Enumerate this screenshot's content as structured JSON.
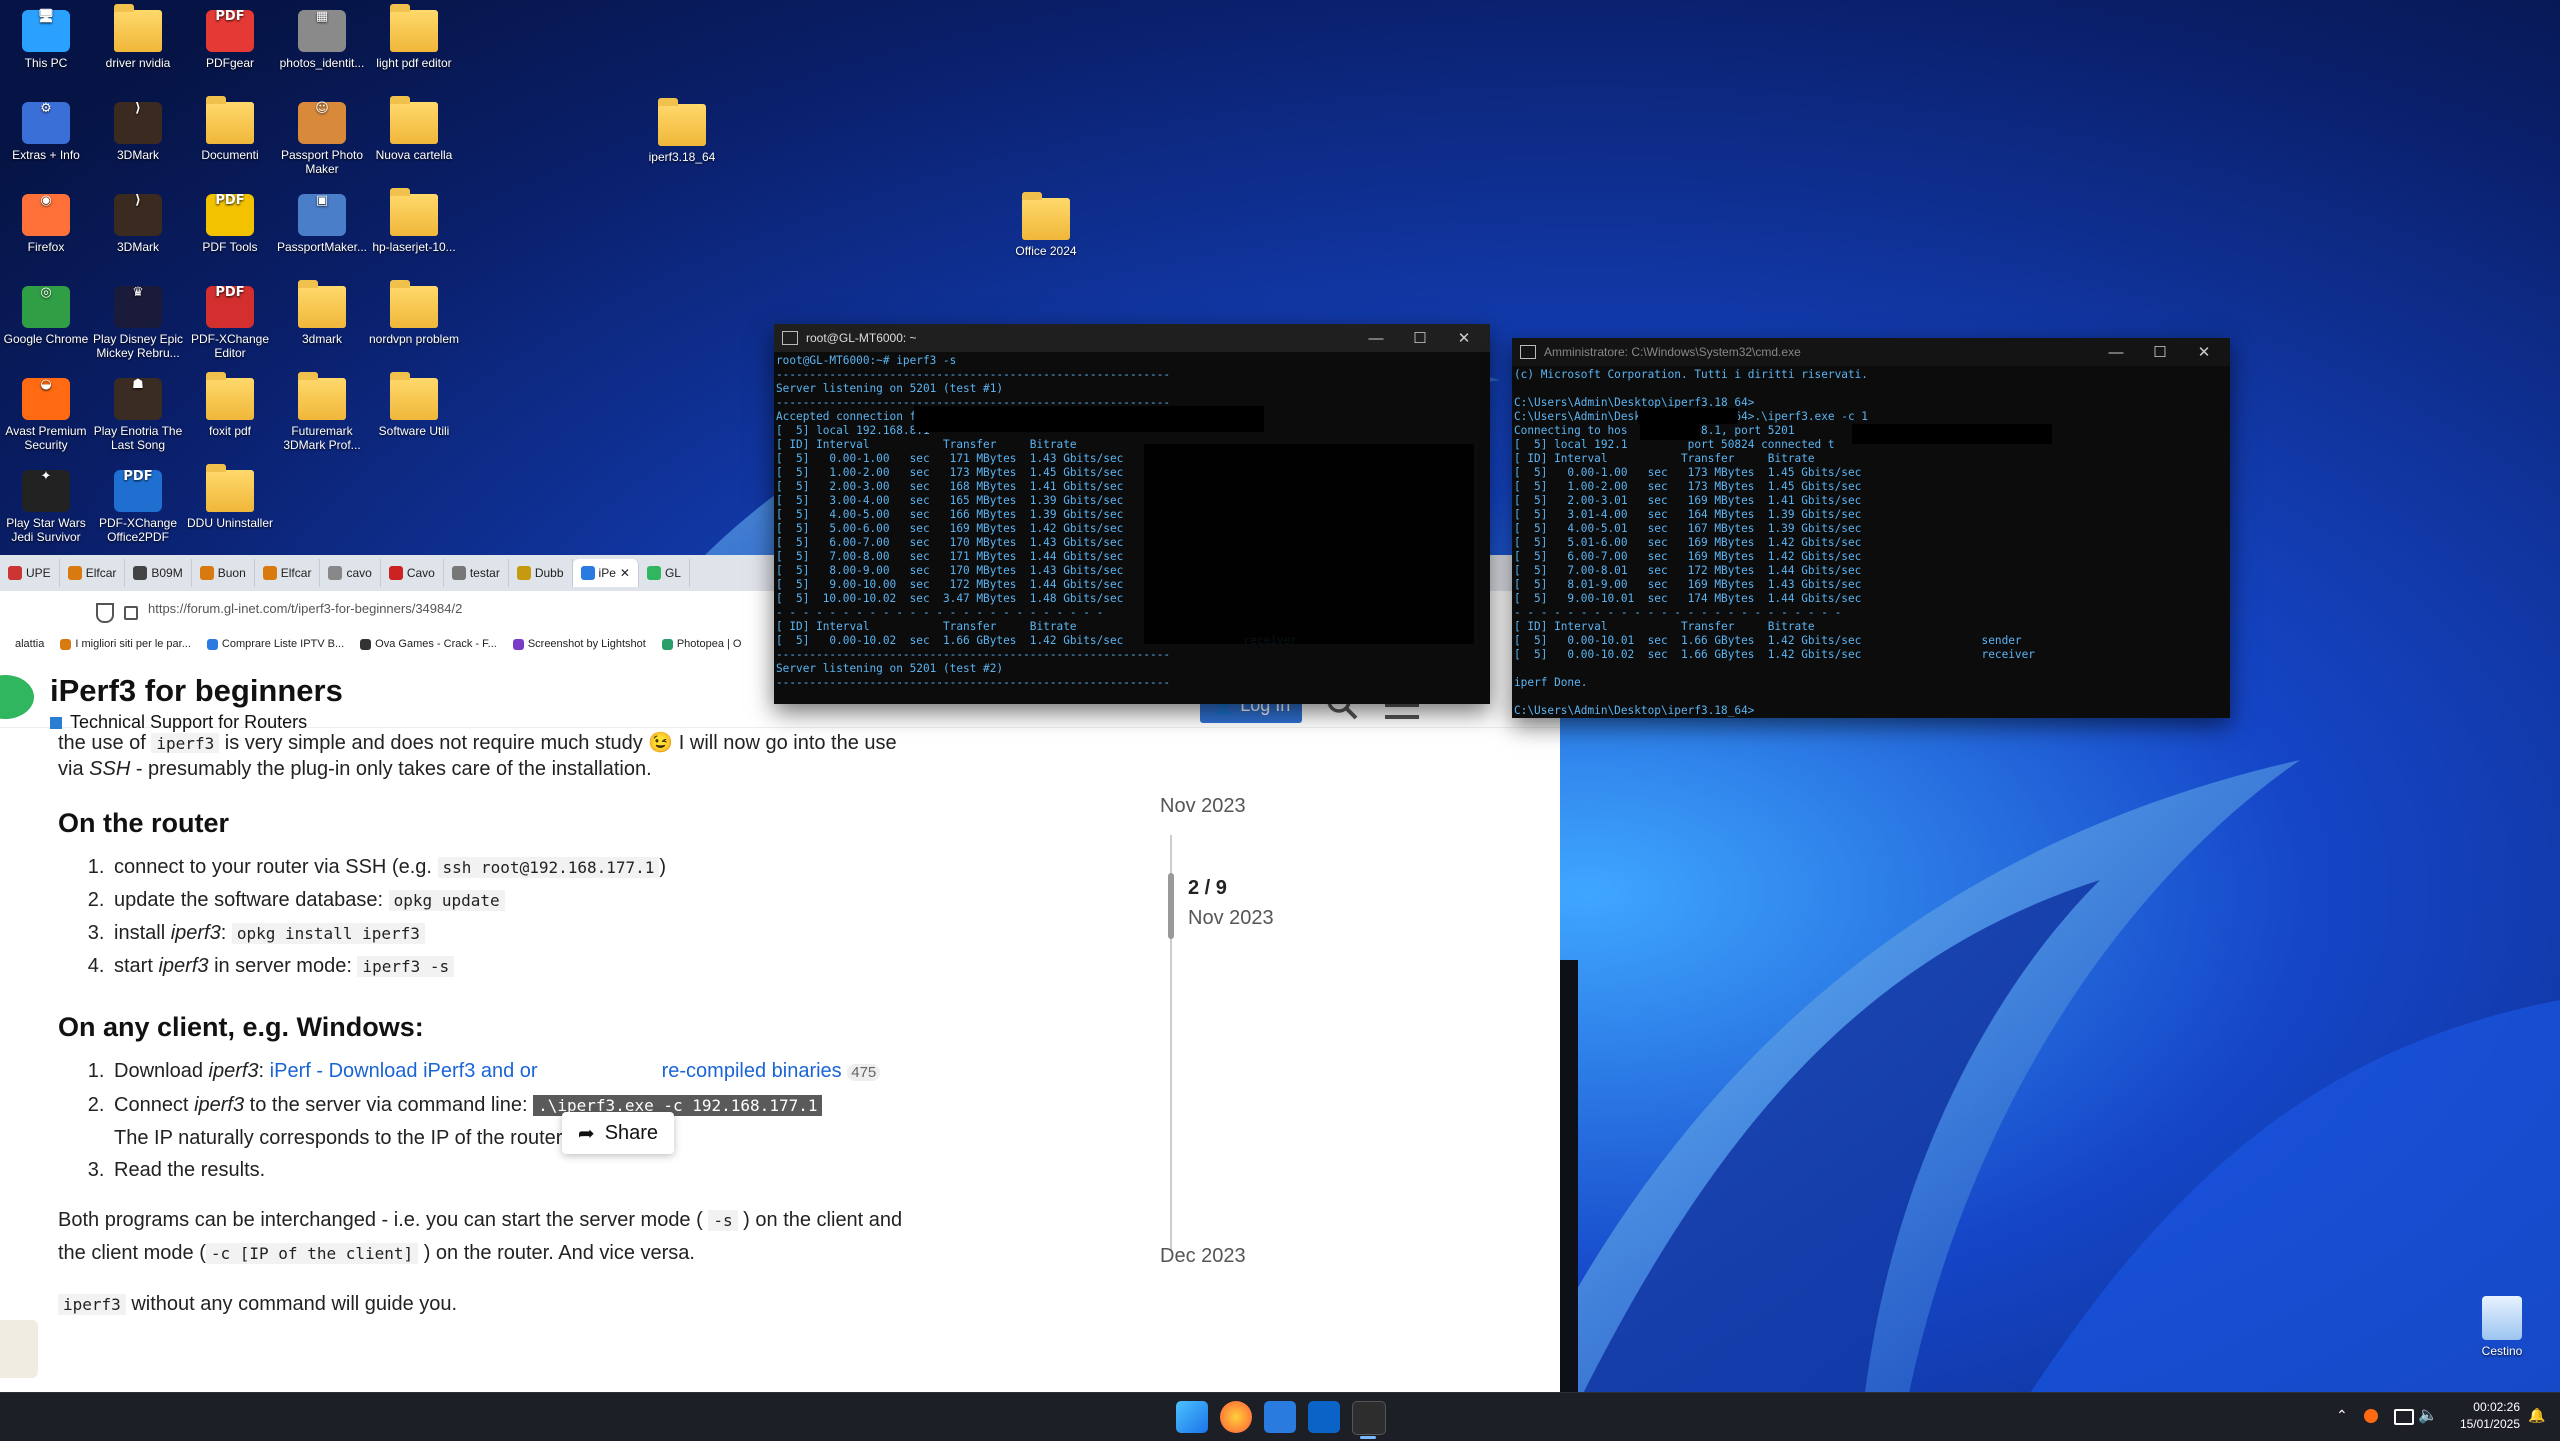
{
  "desktop": {
    "icons": [
      {
        "label": "This PC",
        "color": "#2aa0ff",
        "kind": "tile",
        "glyph": "🖥"
      },
      {
        "label": "driver nvidia",
        "color": "#f0b73a",
        "kind": "folder"
      },
      {
        "label": "PDFgear",
        "color": "#e53935",
        "kind": "tile",
        "glyph": "PDF"
      },
      {
        "label": "photos_identit...",
        "color": "#8a8a8a",
        "kind": "tile",
        "glyph": "▦"
      },
      {
        "label": "light pdf editor",
        "color": "#f0b73a",
        "kind": "folder"
      },
      {
        "label": "Extras + Info",
        "color": "#3b6fd8",
        "kind": "tile",
        "glyph": "⚙"
      },
      {
        "label": "3DMark",
        "color": "#3a2a20",
        "kind": "tile",
        "glyph": "⟩"
      },
      {
        "label": "Documenti",
        "color": "#f0b73a",
        "kind": "folder"
      },
      {
        "label": "Passport Photo Maker",
        "color": "#d88a3a",
        "kind": "tile",
        "glyph": "☺"
      },
      {
        "label": "Nuova cartella",
        "color": "#f0b73a",
        "kind": "folder"
      },
      {
        "label": "Firefox",
        "color": "#ff7139",
        "kind": "tile",
        "glyph": "◉"
      },
      {
        "label": "3DMark",
        "color": "#3a2a20",
        "kind": "tile",
        "glyph": "⟩"
      },
      {
        "label": "PDF Tools",
        "color": "#f2c200",
        "kind": "tile",
        "glyph": "PDF"
      },
      {
        "label": "PassportMaker...",
        "color": "#4a7ec9",
        "kind": "tile",
        "glyph": "▣"
      },
      {
        "label": "hp-laserjet-10...",
        "color": "#f0b73a",
        "kind": "folder"
      },
      {
        "label": "Google Chrome",
        "color": "#2f9e44",
        "kind": "tile",
        "glyph": "◎"
      },
      {
        "label": "Play Disney Epic Mickey Rebru...",
        "color": "#1a1a3a",
        "kind": "tile",
        "glyph": "♛"
      },
      {
        "label": "PDF-XChange Editor",
        "color": "#d32f2f",
        "kind": "tile",
        "glyph": "PDF"
      },
      {
        "label": "3dmark",
        "color": "#f0b73a",
        "kind": "folder"
      },
      {
        "label": "nordvpn problem",
        "color": "#f0b73a",
        "kind": "folder"
      },
      {
        "label": "Avast Premium Security",
        "color": "#ff6a13",
        "kind": "tile",
        "glyph": "◒"
      },
      {
        "label": "Play Enotria The Last Song",
        "color": "#3a2c22",
        "kind": "tile",
        "glyph": "☗"
      },
      {
        "label": "foxit pdf",
        "color": "#f0b73a",
        "kind": "folder"
      },
      {
        "label": "Futuremark 3DMark Prof...",
        "color": "#f0b73a",
        "kind": "folder"
      },
      {
        "label": "Software Utili",
        "color": "#f0b73a",
        "kind": "folder"
      },
      {
        "label": "Play Star Wars Jedi Survivor",
        "color": "#222",
        "kind": "tile",
        "glyph": "✦"
      },
      {
        "label": "PDF-XChange Office2PDF",
        "color": "#1e6fd0",
        "kind": "tile",
        "glyph": "PDF"
      },
      {
        "label": "DDU Uninstaller",
        "color": "#f0b73a",
        "kind": "folder"
      }
    ],
    "loose": [
      {
        "label": "iperf3.18_64"
      },
      {
        "label": "Office 2024"
      }
    ],
    "recycle_bin": "Cestino"
  },
  "browser": {
    "tabs": [
      "UPE",
      "Elfcar",
      "B09M",
      "Buon",
      "Elfcar",
      "cavo",
      "Cavo",
      "testar",
      "Dubb",
      "iPe",
      "GL"
    ],
    "url": "https://forum.gl-inet.com/t/iperf3-for-beginners/34984/2",
    "bookmarks": [
      "alattia",
      "I migliori siti per le par...",
      "Comprare Liste IPTV B...",
      "Ova Games - Crack - F...",
      "Screenshot by Lightshot",
      "Photopea | O"
    ],
    "topic_title": "iPerf3 for beginners",
    "category": "Technical Support for Routers",
    "login": "Log In",
    "share": "Share",
    "post": {
      "intro_a": "the use of",
      "intro_code": "iperf3",
      "intro_b": "is very simple and does not require much study 😉 I will now go into the use",
      "intro_c_a": "via",
      "intro_c_em": "SSH",
      "intro_c_b": "- presumably the plug-in only takes care of the installation.",
      "router_heading": "On the router",
      "router_steps": {
        "s1_a": "connect to your router via SSH (e.g.",
        "s1_code": "ssh root@192.168.177.1",
        "s1_b": ")",
        "s2_a": "update the software database:",
        "s2_code": "opkg update",
        "s3_a": "install",
        "s3_em": "iperf3",
        "s3_b": ":",
        "s3_code": "opkg install iperf3",
        "s4_a": "start",
        "s4_em": "iperf3",
        "s4_b": "in server mode:",
        "s4_code": "iperf3 -s"
      },
      "client_heading": "On any client, e.g. Windows:",
      "client_steps": {
        "c1_a": "Download",
        "c1_em": "iperf3",
        "c1_b": ":",
        "c1_link_a": "iPerf - Download iPerf3 and or",
        "c1_link_b": "re-compiled binaries",
        "c1_badge": "475",
        "c2_a": "Connect",
        "c2_em": "iperf3",
        "c2_b": "to the server via command line:",
        "c2_code": ".\\iperf3.exe -c 192.168.177.1",
        "c2_note": "The IP naturally corresponds to the IP of the router.",
        "c3": "Read the results."
      },
      "outro_a": "Both programs can be interchanged - i.e. you can start the server mode (",
      "outro_code1": "-s",
      "outro_b": ") on the client and",
      "outro_c": "the client mode (",
      "outro_code2": "-c [IP of the client]",
      "outro_d": ") on the router. And vice versa.",
      "last_code": "iperf3",
      "last_text": "without any command will guide you."
    },
    "timeline": {
      "top_date": "Nov 2023",
      "position": "2 / 9",
      "position_date": "Nov 2023",
      "bottom_date": "Dec 2023"
    }
  },
  "terminal_server": {
    "title": "root@GL-MT6000: ~",
    "lines": [
      "root@GL-MT6000:~# iperf3 -s",
      "-----------------------------------------------------------",
      "Server listening on 5201 (test #1)",
      "-----------------------------------------------------------",
      "Accepted connection fro",
      "[  5] local 192.168.8.1",
      "[ ID] Interval           Transfer     Bitrate",
      "[  5]   0.00-1.00   sec   171 MBytes  1.43 Gbits/sec",
      "[  5]   1.00-2.00   sec   173 MBytes  1.45 Gbits/sec",
      "[  5]   2.00-3.00   sec   168 MBytes  1.41 Gbits/sec",
      "[  5]   3.00-4.00   sec   165 MBytes  1.39 Gbits/sec",
      "[  5]   4.00-5.00   sec   166 MBytes  1.39 Gbits/sec",
      "[  5]   5.00-6.00   sec   169 MBytes  1.42 Gbits/sec",
      "[  5]   6.00-7.00   sec   170 MBytes  1.43 Gbits/sec",
      "[  5]   7.00-8.00   sec   171 MBytes  1.44 Gbits/sec",
      "[  5]   8.00-9.00   sec   170 MBytes  1.43 Gbits/sec",
      "[  5]   9.00-10.00  sec   172 MBytes  1.44 Gbits/sec",
      "[  5]  10.00-10.02  sec  3.47 MBytes  1.48 Gbits/sec",
      "- - - - - - - - - - - - - - - - - - - - - - - - -",
      "[ ID] Interval           Transfer     Bitrate",
      "[  5]   0.00-10.02  sec  1.66 GBytes  1.42 Gbits/sec                  receiver",
      "-----------------------------------------------------------",
      "Server listening on 5201 (test #2)",
      "-----------------------------------------------------------"
    ]
  },
  "terminal_client": {
    "title": "Amministratore: C:\\Windows\\System32\\cmd.exe",
    "lines": [
      "(c) Microsoft Corporation. Tutti i diritti riservati.",
      "",
      "C:\\Users\\Admin\\Desktop\\iperf3.18_64>",
      "C:\\Users\\Admin\\Desktop\\iperf3.18_64>.\\iperf3.exe -c 1",
      "Connecting to hos          .8.1, port 5201",
      "[  5] local 192.1         port 50824 connected t",
      "[ ID] Interval           Transfer     Bitrate",
      "[  5]   0.00-1.00   sec   173 MBytes  1.45 Gbits/sec",
      "[  5]   1.00-2.00   sec   173 MBytes  1.45 Gbits/sec",
      "[  5]   2.00-3.01   sec   169 MBytes  1.41 Gbits/sec",
      "[  5]   3.01-4.00   sec   164 MBytes  1.39 Gbits/sec",
      "[  5]   4.00-5.01   sec   167 MBytes  1.39 Gbits/sec",
      "[  5]   5.01-6.00   sec   169 MBytes  1.42 Gbits/sec",
      "[  5]   6.00-7.00   sec   169 MBytes  1.42 Gbits/sec",
      "[  5]   7.00-8.01   sec   172 MBytes  1.44 Gbits/sec",
      "[  5]   8.01-9.00   sec   169 MBytes  1.43 Gbits/sec",
      "[  5]   9.00-10.01  sec   174 MBytes  1.44 Gbits/sec",
      "- - - - - - - - - - - - - - - - - - - - - - - - -",
      "[ ID] Interval           Transfer     Bitrate",
      "[  5]   0.00-10.01  sec  1.66 GBytes  1.42 Gbits/sec                  sender",
      "[  5]   0.00-10.02  sec  1.66 GBytes  1.42 Gbits/sec                  receiver",
      "",
      "iperf Done.",
      "",
      "C:\\Users\\Admin\\Desktop\\iperf3.18_64>"
    ]
  },
  "taskbar": {
    "time": "00:02:26",
    "date": "15/01/2025"
  }
}
